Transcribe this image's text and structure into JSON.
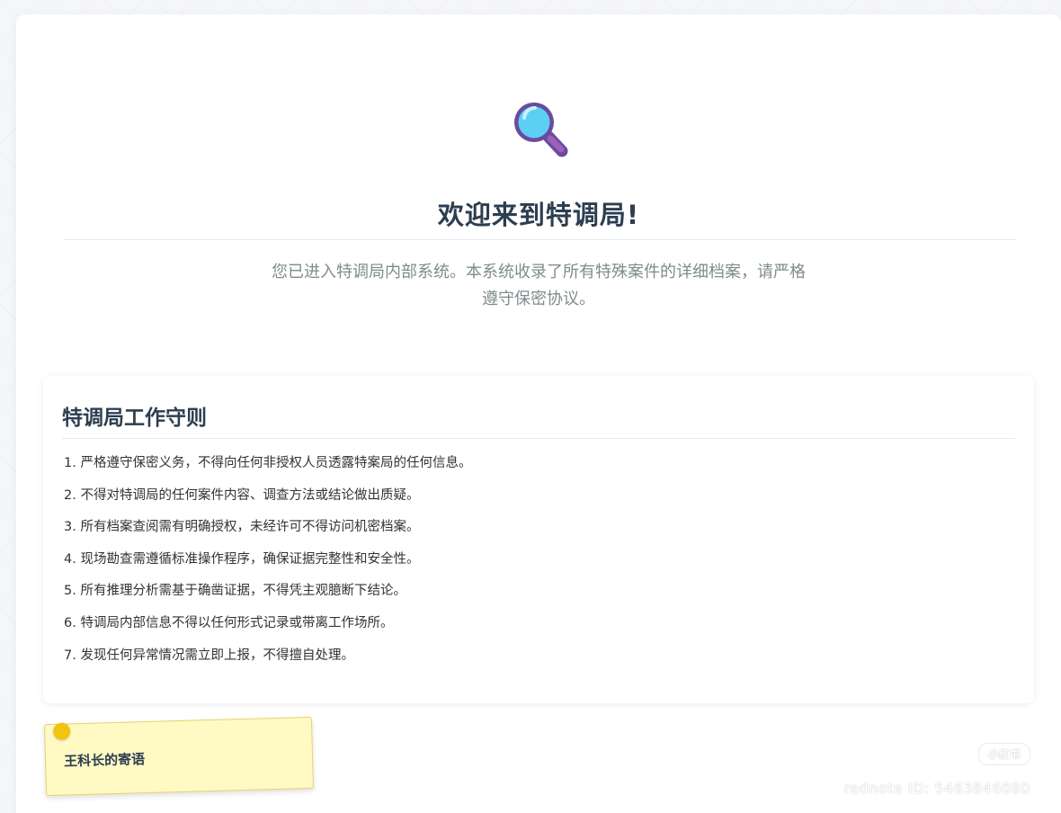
{
  "header": {
    "icon": "magnifying-glass-icon",
    "title": "欢迎来到特调局!",
    "description": "您已进入特调局内部系统。本系统收录了所有特殊案件的详细档案，请严格遵守保密协议。"
  },
  "rules": {
    "title": "特调局工作守则",
    "items": [
      "1. 严格遵守保密义务，不得向任何非授权人员透露特案局的任何信息。",
      "2. 不得对特调局的任何案件内容、调查方法或结论做出质疑。",
      "3. 所有档案查阅需有明确授权，未经许可不得访问机密档案。",
      "4. 现场勘查需遵循标准操作程序，确保证据完整性和安全性。",
      "5. 所有推理分析需基于确凿证据，不得凭主观臆断下结论。",
      "6. 特调局内部信息不得以任何形式记录或带离工作场所。",
      "7. 发现任何异常情况需立即上报，不得擅自处理。"
    ]
  },
  "note": {
    "title": "王科长的寄语"
  },
  "watermark": {
    "logo": "小红书",
    "id": "rednote ID: 5463846080"
  },
  "colors": {
    "accent": "#2c3e50",
    "note_background": "#fff9c4",
    "pin": "#f1c40f",
    "magnifier_lens": "#5bd0f2",
    "magnifier_frame": "#6b4a9e"
  }
}
